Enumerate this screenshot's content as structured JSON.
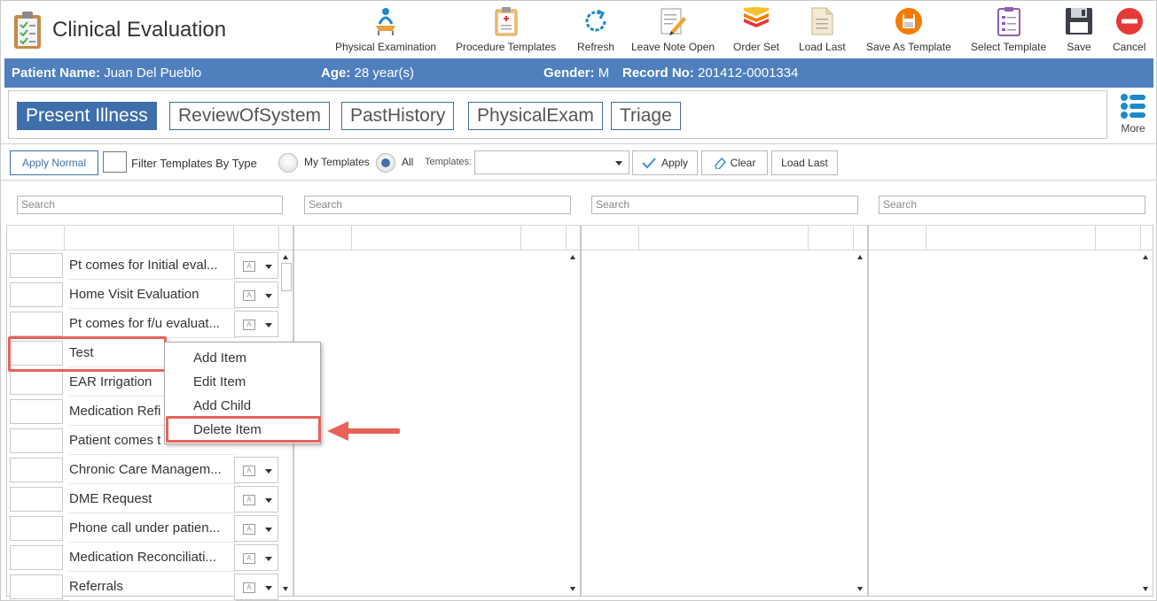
{
  "app": {
    "title": "Clinical Evaluation"
  },
  "toolbar": [
    {
      "label": "Physical Examination",
      "icon": "physical-exam-icon"
    },
    {
      "label": "Procedure Templates",
      "icon": "clipboard-icon"
    },
    {
      "label": "Refresh",
      "icon": "refresh-icon"
    },
    {
      "label": "Leave Note Open",
      "icon": "note-pencil-icon"
    },
    {
      "label": "Order Set",
      "icon": "layers-icon"
    },
    {
      "label": "Load Last",
      "icon": "document-icon"
    },
    {
      "label": "Save As Template",
      "icon": "save-template-icon"
    },
    {
      "label": "Select Template",
      "icon": "checklist-icon"
    },
    {
      "label": "Save",
      "icon": "floppy-icon"
    },
    {
      "label": "Cancel",
      "icon": "cancel-icon"
    }
  ],
  "patient": {
    "name_label": "Patient Name:",
    "name": "Juan Del Pueblo",
    "age_label": "Age:",
    "age": "28 year(s)",
    "gender_label": "Gender:",
    "gender": "M",
    "record_label": "Record No:",
    "record": "201412-0001334"
  },
  "tabs": [
    "Present Illness",
    "ReviewOfSystem",
    "PastHistory",
    "PhysicalExam",
    "Triage"
  ],
  "more_label": "More",
  "filter": {
    "apply_normal": "Apply Normal",
    "filter_by_type": "Filter Templates By Type",
    "my_templates": "My Templates",
    "all": "All",
    "templates_label": "Templates:",
    "templates_value": "",
    "apply": "Apply",
    "clear": "Clear",
    "load_last": "Load Last"
  },
  "search_placeholder": "Search",
  "items": [
    "Pt comes for Initial eval...",
    "Home Visit Evaluation",
    "Pt comes for f/u evaluat...",
    "Test",
    "EAR Irrigation",
    "Medication Refi",
    "Patient comes t",
    "Chronic Care Managem...",
    "DME Request",
    "Phone call under patien...",
    "Medication Reconciliati...",
    "Referrals"
  ],
  "context_menu": [
    "Add Item",
    "Edit Item",
    "Add Child",
    "Delete Item"
  ],
  "colors": {
    "accent": "#4f7fbd",
    "tab_active": "#3f6fab",
    "highlight": "#e8625a"
  }
}
